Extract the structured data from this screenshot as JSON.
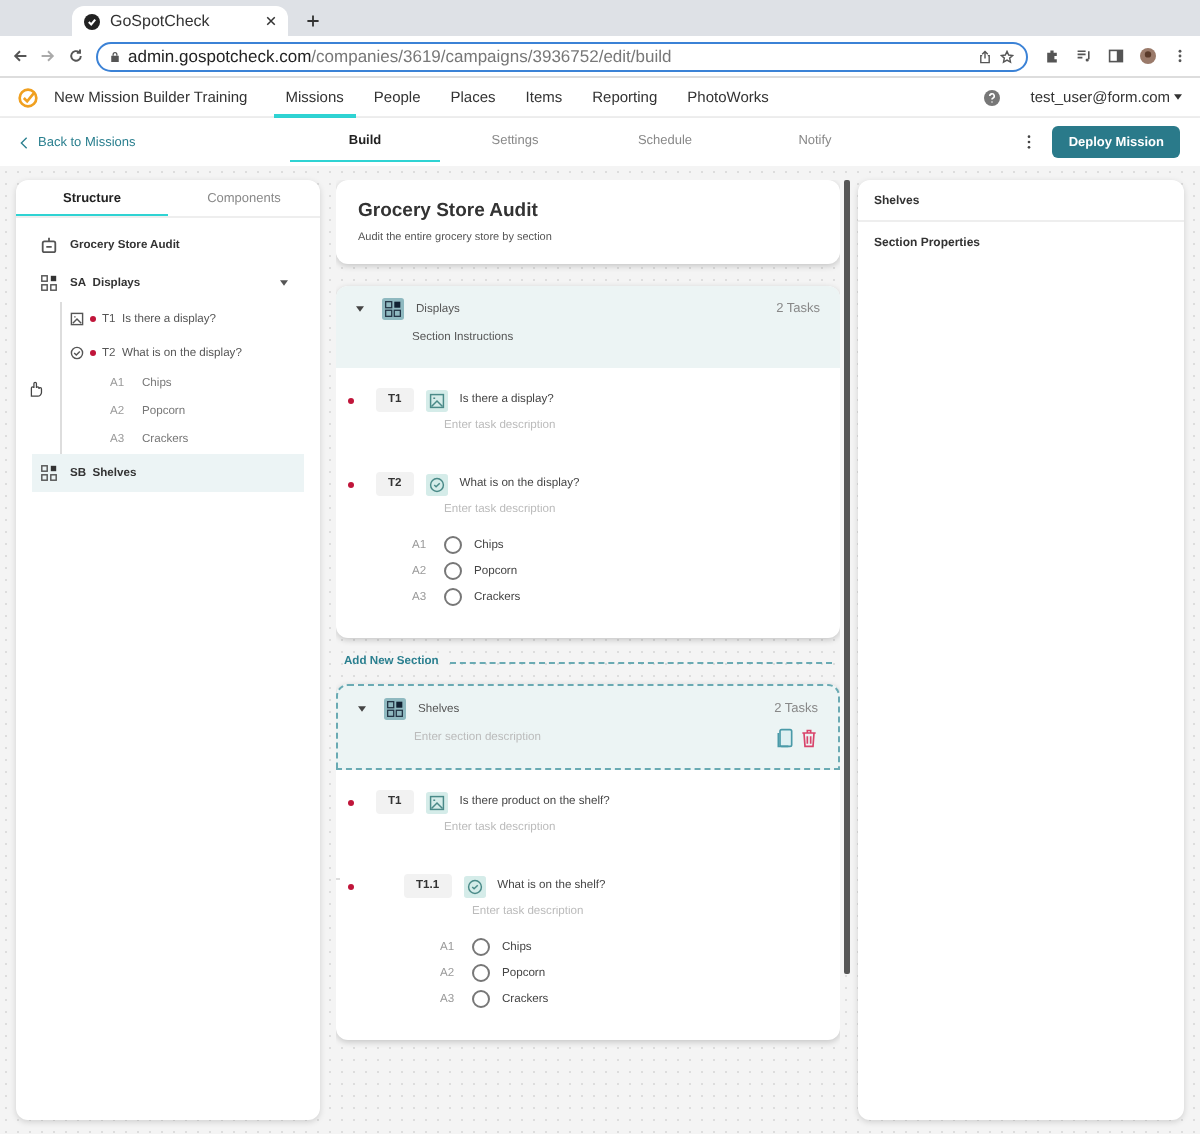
{
  "browser": {
    "tab_title": "GoSpotCheck",
    "url_host": "admin.gospotcheck.com",
    "url_path": "/companies/3619/campaigns/3936752/edit/build"
  },
  "nav": {
    "brand": "New Mission Builder Training",
    "items": [
      {
        "label": "Missions",
        "selected": true
      },
      {
        "label": "People",
        "selected": false
      },
      {
        "label": "Places",
        "selected": false
      },
      {
        "label": "Items",
        "selected": false
      },
      {
        "label": "Reporting",
        "selected": false
      },
      {
        "label": "PhotoWorks",
        "selected": false
      }
    ],
    "user": "test_user@form.com"
  },
  "subnav": {
    "back": "Back to Missions",
    "tabs": [
      {
        "label": "Build",
        "selected": true
      },
      {
        "label": "Settings",
        "selected": false
      },
      {
        "label": "Schedule",
        "selected": false
      },
      {
        "label": "Notify",
        "selected": false
      }
    ],
    "deploy": "Deploy Mission"
  },
  "structure": {
    "tabs": [
      {
        "label": "Structure",
        "selected": true
      },
      {
        "label": "Components",
        "selected": false
      }
    ],
    "mission": "Grocery Store Audit",
    "sections": [
      {
        "code": "SA",
        "name": "Displays",
        "expanded": true,
        "selected": false,
        "tasks": [
          {
            "code": "T1",
            "question": "Is there a display?",
            "kind": "image",
            "required": true
          },
          {
            "code": "T2",
            "question": "What is on the display?",
            "kind": "choice",
            "required": true,
            "answers": [
              {
                "code": "A1",
                "label": "Chips"
              },
              {
                "code": "A2",
                "label": "Popcorn"
              },
              {
                "code": "A3",
                "label": "Crackers"
              }
            ]
          }
        ]
      },
      {
        "code": "SB",
        "name": "Shelves",
        "expanded": false,
        "selected": true
      }
    ]
  },
  "canvas": {
    "title": "Grocery Store Audit",
    "description": "Audit the entire grocery store by section",
    "add_section": "Add New Section",
    "sections": [
      {
        "name": "Displays",
        "count": "2 Tasks",
        "expanded": true,
        "selected": false,
        "description": "Section Instructions",
        "tasks": [
          {
            "code": "T1",
            "kind": "image",
            "required": true,
            "question": "Is there a display?",
            "placeholder": "Enter task description"
          },
          {
            "code": "T2",
            "kind": "choice",
            "required": true,
            "question": "What is on the display?",
            "placeholder": "Enter task description",
            "answers": [
              {
                "code": "A1",
                "label": "Chips"
              },
              {
                "code": "A2",
                "label": "Popcorn"
              },
              {
                "code": "A3",
                "label": "Crackers"
              }
            ]
          }
        ]
      },
      {
        "name": "Shelves",
        "count": "2 Tasks",
        "expanded": true,
        "selected": true,
        "description_placeholder": "Enter section description",
        "tasks": [
          {
            "code": "T1",
            "kind": "image",
            "required": true,
            "question": "Is there product on the shelf?",
            "placeholder": "Enter task description",
            "children": [
              {
                "code": "T1.1",
                "kind": "choice",
                "required": true,
                "question": "What is on the shelf?",
                "placeholder": "Enter task description",
                "answers": [
                  {
                    "code": "A1",
                    "label": "Chips"
                  },
                  {
                    "code": "A2",
                    "label": "Popcorn"
                  },
                  {
                    "code": "A3",
                    "label": "Crackers"
                  }
                ]
              }
            ]
          }
        ]
      }
    ]
  },
  "properties": {
    "title": "Shelves",
    "heading": "Section Properties"
  }
}
